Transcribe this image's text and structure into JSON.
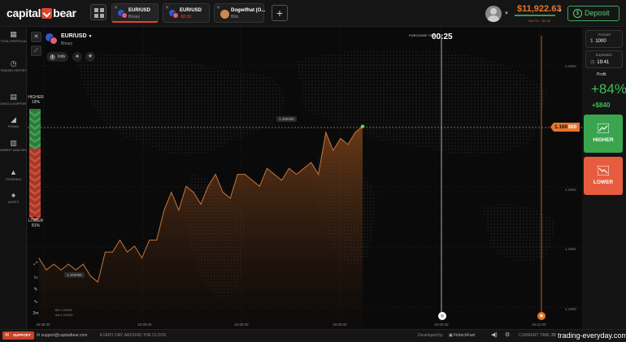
{
  "brand": {
    "name_left": "capital",
    "name_right": "bear"
  },
  "tabs": [
    {
      "name": "EUR/USD",
      "sub": "Binary",
      "active": true
    },
    {
      "name": "EUR/USD",
      "sub": "-$0.05",
      "active": false
    },
    {
      "name": "Dogwifhat (O...",
      "sub": "Blitz",
      "active": false
    }
  ],
  "account": {
    "balance": "$11,922.63",
    "sub": "Net P/L: -$0.05"
  },
  "deposit_label": "Deposit",
  "sidebar": [
    {
      "label": "TOTAL PORTFOLIO",
      "icon": "briefcase-icon",
      "glyph": "▦"
    },
    {
      "label": "TRADING HISTORY",
      "icon": "clock-icon",
      "glyph": "◷"
    },
    {
      "label": "CHATS & SUPPORT",
      "icon": "chat-icon",
      "glyph": "▤"
    },
    {
      "label": "PROMO",
      "icon": "megaphone-icon",
      "glyph": "◢"
    },
    {
      "label": "MARKET ANALYSIS",
      "icon": "analysis-icon",
      "glyph": "▥"
    },
    {
      "label": "TUTORIALS",
      "icon": "graduation-icon",
      "glyph": "▲"
    },
    {
      "label": "ALERTS",
      "icon": "bell-icon",
      "glyph": "♠"
    }
  ],
  "asset": {
    "name": "EUR/USD",
    "type": "Binary",
    "info_label": "Info"
  },
  "purchase": {
    "label": "PURCHASE TIME",
    "time": "00:25"
  },
  "sentiment": {
    "higher_label": "HIGHER",
    "higher_pct": "19%",
    "lower_label": "LOWER",
    "lower_pct": "81%"
  },
  "chart_data": {
    "type": "area",
    "series": [
      {
        "values": [
          1.16008,
          1.16006,
          1.16007,
          1.16006,
          1.16007,
          1.16006,
          1.16007,
          1.16005,
          1.16004,
          1.16009,
          1.16009,
          1.16011,
          1.16009,
          1.1601,
          1.16008,
          1.16011,
          1.16011,
          1.16016,
          1.16019,
          1.16016,
          1.1602,
          1.16019,
          1.16017,
          1.1602,
          1.16022,
          1.16019,
          1.16018,
          1.16022,
          1.16022,
          1.16021,
          1.1602,
          1.16023,
          1.16022,
          1.16021,
          1.16023,
          1.16022,
          1.16023,
          1.16024,
          1.16022,
          1.16029,
          1.16026,
          1.16028,
          1.16027,
          1.16029,
          1.1603
        ]
      }
    ],
    "yticks": [
      "1.1604",
      "1.1603",
      "1.1602",
      "1.1601",
      "1.1600"
    ],
    "xticks": [
      "19:38:30",
      "19:39:00",
      "19:39:30",
      "19:40:00",
      "19:40:30",
      "19:41:00"
    ],
    "max_label": "1.160305",
    "min_label": "1.160065",
    "current_price": "1.160300",
    "current_price_main": "1.160",
    "current_price_tail": "300",
    "notes": [
      "Bid 1.160300",
      "Ask 1.160300"
    ]
  },
  "chart_tools": [
    "1s",
    "2m"
  ],
  "markers": {
    "purchase_icon": "◎",
    "expiry_icon": "◉"
  },
  "amount": {
    "label": "Amount",
    "currency": "$",
    "value": "1000"
  },
  "expiration": {
    "label": "Expiration",
    "value": "19:41"
  },
  "profit": {
    "label": "Profit",
    "percent": "+84%",
    "amount": "+$840"
  },
  "actions": {
    "higher": "HIGHER",
    "lower": "LOWER"
  },
  "footer": {
    "support": "SUPPORT",
    "email": "support@capitalbear.com",
    "tagline": "EVERY DAY, AROUND THE CLOCK",
    "developed_by": "Developed by",
    "developer": "FintechFuel",
    "current_time_label": "CURRENT TIME:",
    "current_time": "20",
    "watermark": "trading-everyday.com"
  },
  "colors": {
    "accent": "#e8742c",
    "up": "#3aa54e",
    "down": "#e55d3e"
  }
}
